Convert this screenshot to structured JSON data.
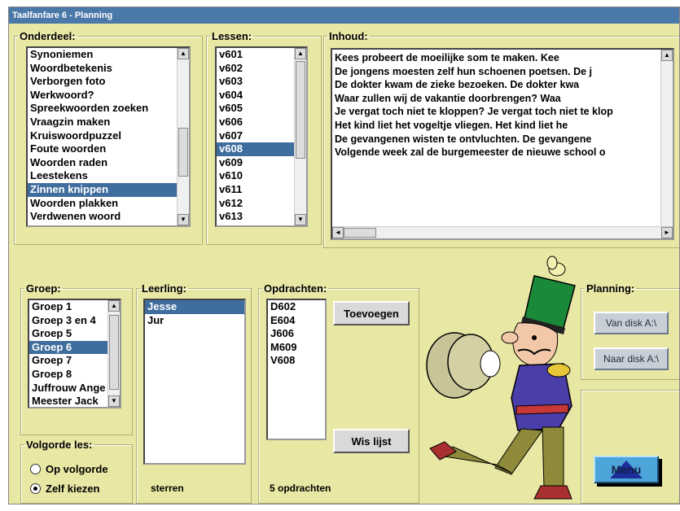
{
  "window": {
    "title": "Taalfanfare 6 - Planning"
  },
  "onderdeel": {
    "legend": "Onderdeel:",
    "items": [
      "Synoniemen",
      "Woordbetekenis",
      "Verborgen foto",
      "Werkwoord?",
      "Spreekwoorden zoeken",
      "Vraagzin maken",
      "Kruiswoordpuzzel",
      "Foute woorden",
      "Woorden raden",
      "Leestekens",
      "Zinnen knippen",
      "Woorden plakken",
      "Verdwenen woord"
    ],
    "selected": "Zinnen knippen"
  },
  "lessen": {
    "legend": "Lessen:",
    "items": [
      "v601",
      "v602",
      "v603",
      "v604",
      "v605",
      "v606",
      "v607",
      "v608",
      "v609",
      "v610",
      "v611",
      "v612",
      "v613"
    ],
    "selected": "v608"
  },
  "inhoud": {
    "legend": "Inhoud:",
    "lines": [
      "Kees probeert de moeilijke som te maken.          Kee",
      "De jongens moesten zelf hun schoenen poetsen.    De j",
      "De dokter kwam de zieke bezoeken.       De dokter kwa",
      "Waar zullen wij de vakantie doorbrengen?            Waa",
      "Je vergat toch niet te kloppen? Je vergat toch niet te klop",
      "Het kind liet het vogeltje vliegen.          Het kind liet he",
      "De gevangenen wisten te ontvluchten.     De gevangene",
      "Volgende week zal de burgemeester de nieuwe school o"
    ]
  },
  "groep": {
    "legend": "Groep:",
    "items": [
      "Groep 1",
      "Groep 3 en 4",
      "Groep 5",
      "Groep 6",
      "Groep 7",
      "Groep 8",
      "Juffrouw Ange",
      "Meester Jack"
    ],
    "selected": "Groep 6"
  },
  "leerling": {
    "legend": "Leerling:",
    "items": [
      "Jesse",
      "Jur"
    ],
    "selected": "Jesse",
    "footer": "sterren"
  },
  "opdrachten": {
    "legend": "Opdrachten:",
    "items": [
      "D602",
      "E604",
      "J606",
      "M609",
      "V608"
    ],
    "footer": "5 opdrachten",
    "add_label": "Toevoegen",
    "clear_label": "Wis lijst"
  },
  "volgorde": {
    "legend": "Volgorde les:",
    "options": [
      "Op volgorde",
      "Zelf kiezen"
    ],
    "selected": "Zelf kiezen"
  },
  "planning": {
    "legend": "Planning:",
    "from_label": "Van disk A:\\",
    "to_label": "Naar disk A:\\"
  },
  "menu": {
    "label": "Menu"
  },
  "colors": {
    "background": "#e8e7a4",
    "titlebar": "#4a78a8",
    "selection": "#3f6d9d",
    "menu_button": "#4da4d8"
  }
}
